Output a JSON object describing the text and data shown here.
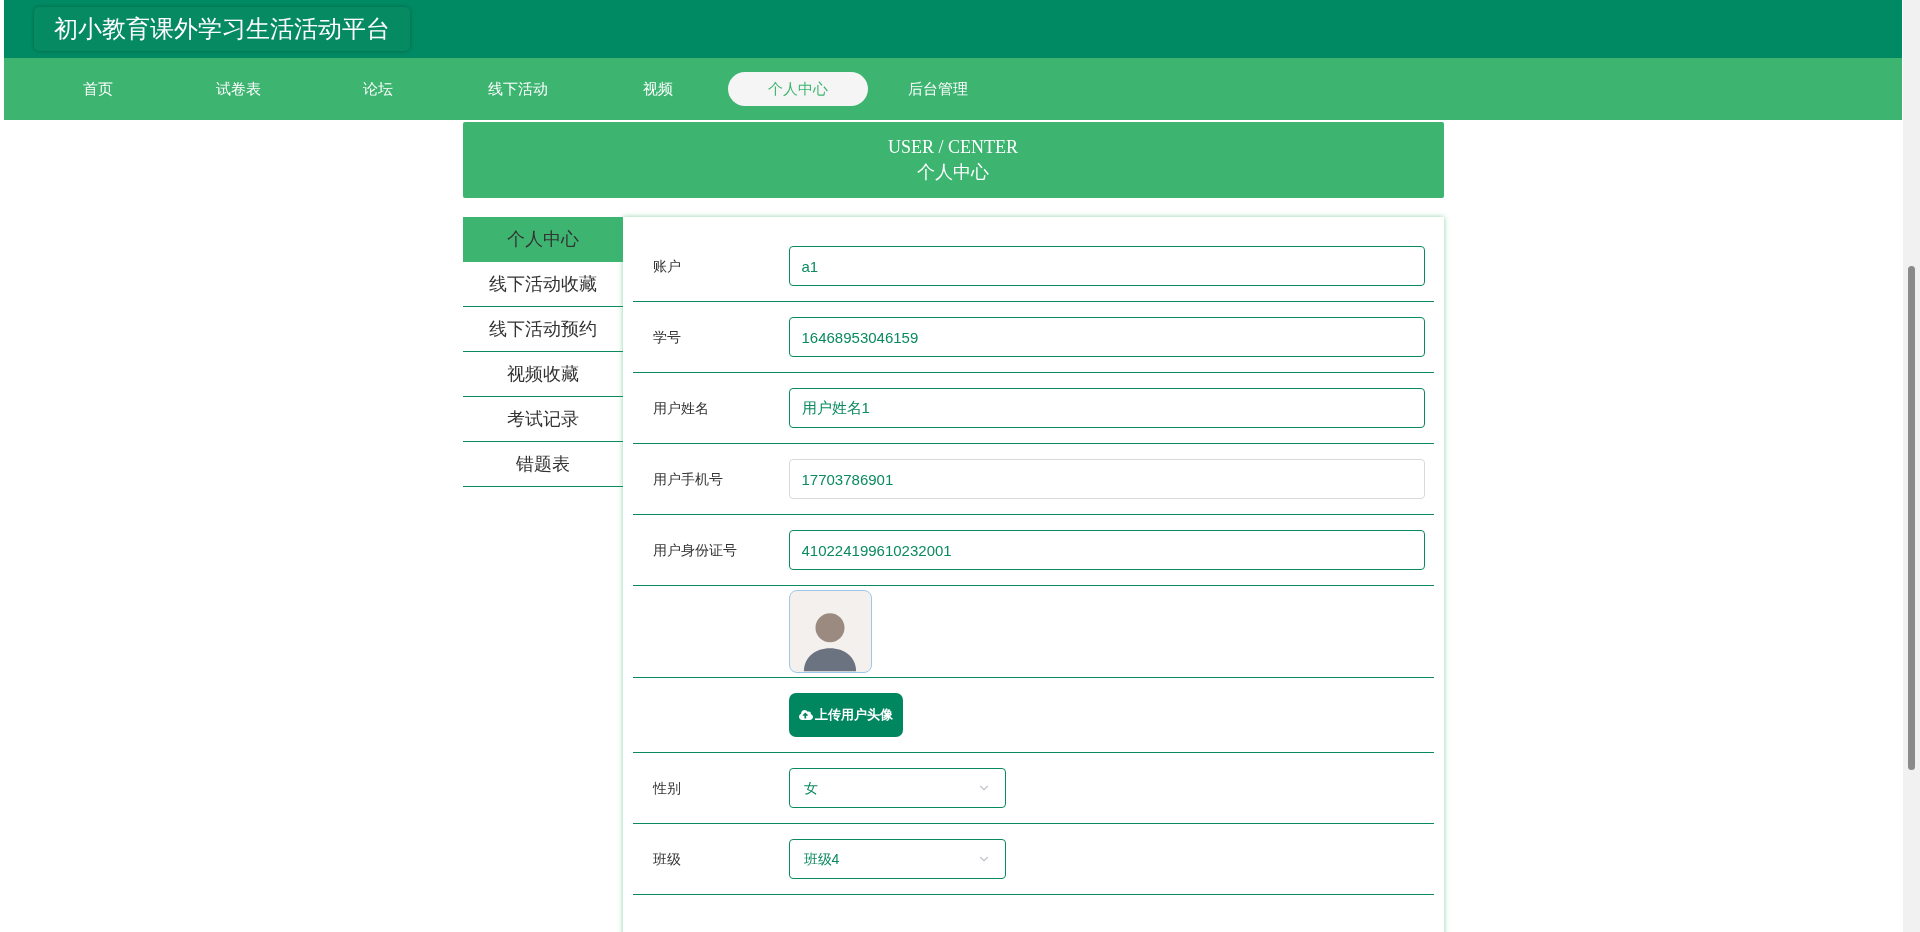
{
  "site_title": "初小教育课外学习生活活动平台",
  "nav": [
    {
      "label": "首页",
      "selected": false
    },
    {
      "label": "试卷表",
      "selected": false
    },
    {
      "label": "论坛",
      "selected": false
    },
    {
      "label": "线下活动",
      "selected": false
    },
    {
      "label": "视频",
      "selected": false
    },
    {
      "label": "个人中心",
      "selected": true
    },
    {
      "label": "后台管理",
      "selected": false
    }
  ],
  "banner": {
    "title_en": "USER / CENTER",
    "title": "个人中心"
  },
  "sidebar": {
    "items": [
      {
        "label": "个人中心",
        "selected": true
      },
      {
        "label": "线下活动收藏",
        "selected": false
      },
      {
        "label": "线下活动预约",
        "selected": false
      },
      {
        "label": "视频收藏",
        "selected": false
      },
      {
        "label": "考试记录",
        "selected": false
      },
      {
        "label": "错题表",
        "selected": false
      }
    ]
  },
  "form": {
    "rows": [
      {
        "kind": "text",
        "label": "账户",
        "value": "a1",
        "disabled": false
      },
      {
        "kind": "text",
        "label": "学号",
        "value": "16468953046159",
        "disabled": false
      },
      {
        "kind": "text",
        "label": "用户姓名",
        "value": "用户姓名1",
        "disabled": false
      },
      {
        "kind": "text",
        "label": "用户手机号",
        "value": "17703786901",
        "disabled": true
      },
      {
        "kind": "text",
        "label": "用户身份证号",
        "value": "410224199610232001",
        "disabled": false
      },
      {
        "kind": "image"
      },
      {
        "kind": "upload",
        "button": "上传用户头像"
      },
      {
        "kind": "select",
        "label": "性别",
        "value": "女"
      },
      {
        "kind": "select",
        "label": "班级",
        "value": "班级4"
      }
    ]
  }
}
